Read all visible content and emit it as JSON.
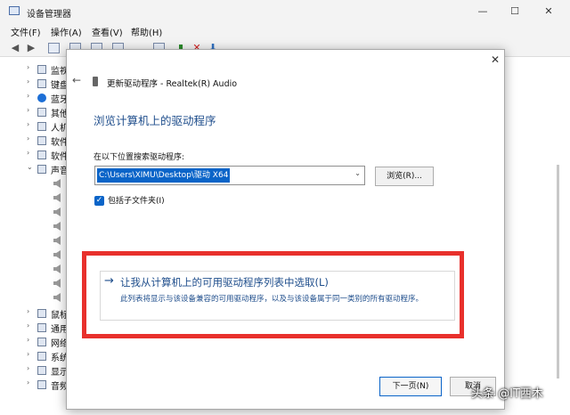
{
  "window": {
    "title": "设备管理器",
    "minimize_glyph": "—",
    "maximize_glyph": "☐",
    "close_glyph": "✕"
  },
  "menubar": {
    "items": [
      "文件(F)",
      "操作(A)",
      "查看(V)",
      "帮助(H)"
    ]
  },
  "tree": {
    "items": [
      {
        "label": "监视",
        "arrow": "›"
      },
      {
        "label": "键盘",
        "arrow": "›"
      },
      {
        "label": "蓝牙",
        "arrow": "›"
      },
      {
        "label": "其他",
        "arrow": "›"
      },
      {
        "label": "人机",
        "arrow": "›"
      },
      {
        "label": "软件",
        "arrow": "›"
      },
      {
        "label": "软件",
        "arrow": "›"
      },
      {
        "label": "声音",
        "arrow": "⌄"
      },
      {
        "label": "鼠标",
        "arrow": "›"
      },
      {
        "label": "通用",
        "arrow": "›"
      },
      {
        "label": "网络",
        "arrow": "›"
      },
      {
        "label": "系统",
        "arrow": "›"
      },
      {
        "label": "显示",
        "arrow": "›"
      },
      {
        "label": "音频",
        "arrow": "›"
      }
    ]
  },
  "dialog": {
    "close_glyph": "✕",
    "back_glyph": "←",
    "title": "更新驱动程序 - Realtek(R) Audio",
    "heading": "浏览计算机上的驱动程序",
    "search_label": "在以下位置搜索驱动程序:",
    "path_value": "C:\\Users\\XIMU\\Desktop\\驱动 X64",
    "combo_arrow": "⌄",
    "browse_label": "浏览(R)...",
    "checkbox_checked": true,
    "checkbox_glyph": "✓",
    "checkbox_label": "包括子文件夹(I)",
    "pick_arrow": "→",
    "pick_title": "让我从计算机上的可用驱动程序列表中选取(L)",
    "pick_desc": "此列表将显示与该设备兼容的可用驱动程序，以及与该设备属于同一类别的所有驱动程序。",
    "next_label": "下一页(N)",
    "cancel_label": "取消"
  },
  "watermark": "头条 @IT西木",
  "colors": {
    "accent_blue": "#0a64c8",
    "link_blue": "#1f4e8c",
    "highlight_red": "#e8302c"
  }
}
